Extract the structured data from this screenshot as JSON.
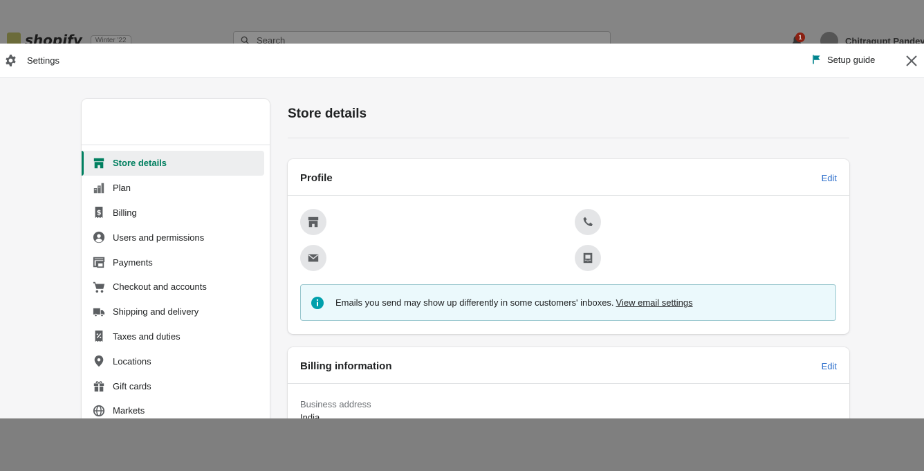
{
  "background": {
    "brand": "shopify",
    "badge": "Winter '22",
    "search_placeholder": "Search",
    "notification_count": "1",
    "username": "Chitragupt Pandey"
  },
  "header": {
    "title": "Settings",
    "setup_guide": "Setup guide"
  },
  "sidebar": {
    "items": [
      {
        "label": "Store details",
        "icon": "store-icon",
        "active": true
      },
      {
        "label": "Plan",
        "icon": "plan-icon"
      },
      {
        "label": "Billing",
        "icon": "billing-icon"
      },
      {
        "label": "Users and permissions",
        "icon": "user-icon"
      },
      {
        "label": "Payments",
        "icon": "payments-icon"
      },
      {
        "label": "Checkout and accounts",
        "icon": "cart-icon"
      },
      {
        "label": "Shipping and delivery",
        "icon": "truck-icon"
      },
      {
        "label": "Taxes and duties",
        "icon": "tax-icon"
      },
      {
        "label": "Locations",
        "icon": "location-icon"
      },
      {
        "label": "Gift cards",
        "icon": "gift-icon"
      },
      {
        "label": "Markets",
        "icon": "globe-icon"
      }
    ]
  },
  "main": {
    "title": "Store details",
    "profile": {
      "title": "Profile",
      "edit": "Edit",
      "banner_text": "Emails you send may show up differently in some customers' inboxes.",
      "banner_link": "View email settings"
    },
    "billing": {
      "title": "Billing information",
      "edit": "Edit",
      "address_label": "Business address",
      "address_value": "India"
    }
  },
  "colors": {
    "accent": "#008060",
    "link": "#2c6ecb",
    "banner_bg": "#ebf9fc",
    "info_icon": "#00a0ac",
    "flag": "#00848e"
  }
}
